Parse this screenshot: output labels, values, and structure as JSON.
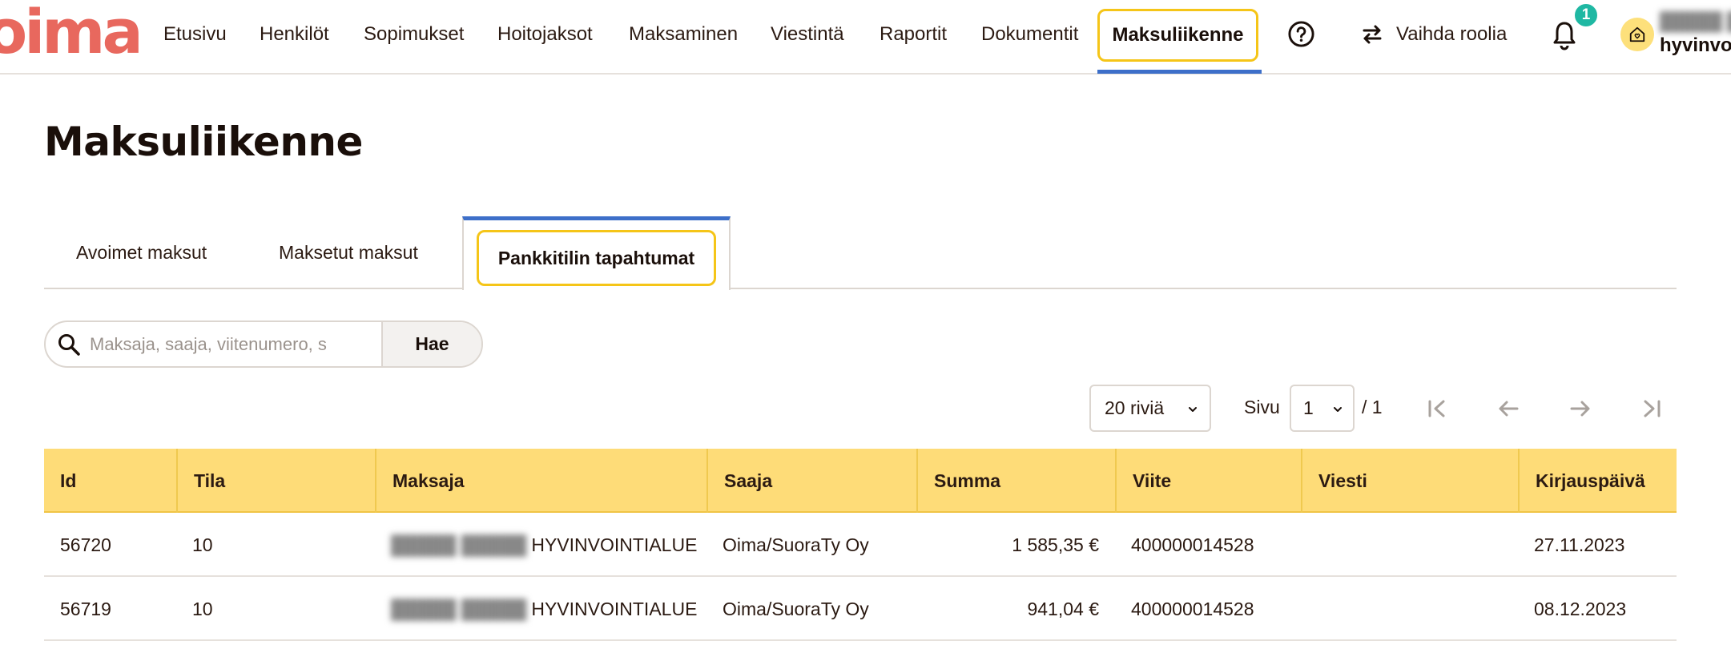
{
  "logo": "oima",
  "nav": {
    "items": [
      "Etusivu",
      "Henkilöt",
      "Sopimukset",
      "Hoitojaksot",
      "Maksaminen",
      "Viestintä",
      "Raportit",
      "Dokumentit"
    ],
    "active": "Maksuliikenne",
    "switch_role": "Vaihda roolia",
    "notification_count": "1",
    "user_org": "hyvinvo"
  },
  "page": {
    "title": "Maksuliikenne"
  },
  "tabs": [
    "Avoimet maksut",
    "Maksetut maksut",
    "Pankkitilin tapahtumat"
  ],
  "search": {
    "placeholder": "Maksaja, saaja, viitenumero, s",
    "button": "Hae"
  },
  "pagination": {
    "rows": "20 riviä",
    "page_label": "Sivu",
    "page": "1",
    "total": "/ 1"
  },
  "table": {
    "headers": [
      "Id",
      "Tila",
      "Maksaja",
      "Saaja",
      "Summa",
      "Viite",
      "Viesti",
      "Kirjauspäivä"
    ],
    "rows": [
      {
        "id": "56720",
        "tila": "10",
        "maksaja": "HYVINVOINTIALUE",
        "saaja": "Oima/SuoraTy Oy",
        "summa": "1 585,35 €",
        "viite": "400000014528",
        "viesti": "",
        "kirjauspaiva": "27.11.2023"
      },
      {
        "id": "56719",
        "tila": "10",
        "maksaja": "HYVINVOINTIALUE",
        "saaja": "Oima/SuoraTy Oy",
        "summa": "941,04 €",
        "viite": "400000014528",
        "viesti": "",
        "kirjauspaiva": "08.12.2023"
      }
    ]
  },
  "colors": {
    "brand": "#e8685e",
    "highlight": "#f5c518",
    "accent": "#3d6fc9",
    "table_header": "#fedc78",
    "badge": "#1fb8a3"
  }
}
